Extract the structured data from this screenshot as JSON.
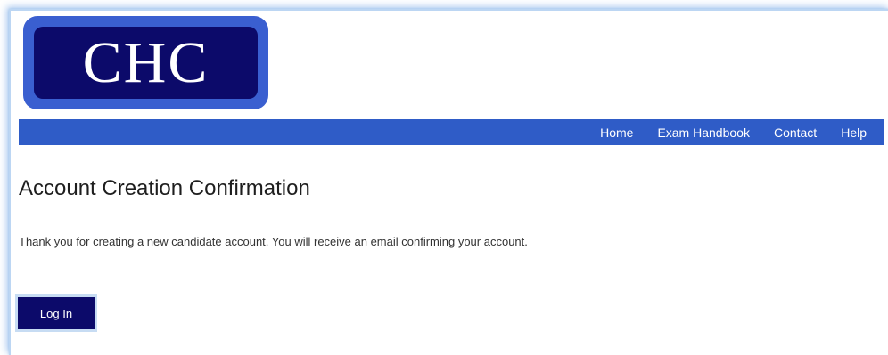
{
  "logo": {
    "text": "CHC",
    "outer_color": "#3a5fd0",
    "inner_color": "#0c0a6a"
  },
  "nav": {
    "background": "#2f5cc7",
    "items": [
      {
        "label": "Home"
      },
      {
        "label": "Exam Handbook"
      },
      {
        "label": "Contact"
      },
      {
        "label": "Help"
      }
    ]
  },
  "main": {
    "title": "Account Creation Confirmation",
    "message": "Thank you for creating a new candidate account. You will receive an email confirming your account.",
    "login_button_label": "Log In",
    "button_color": "#0c0a6a"
  }
}
